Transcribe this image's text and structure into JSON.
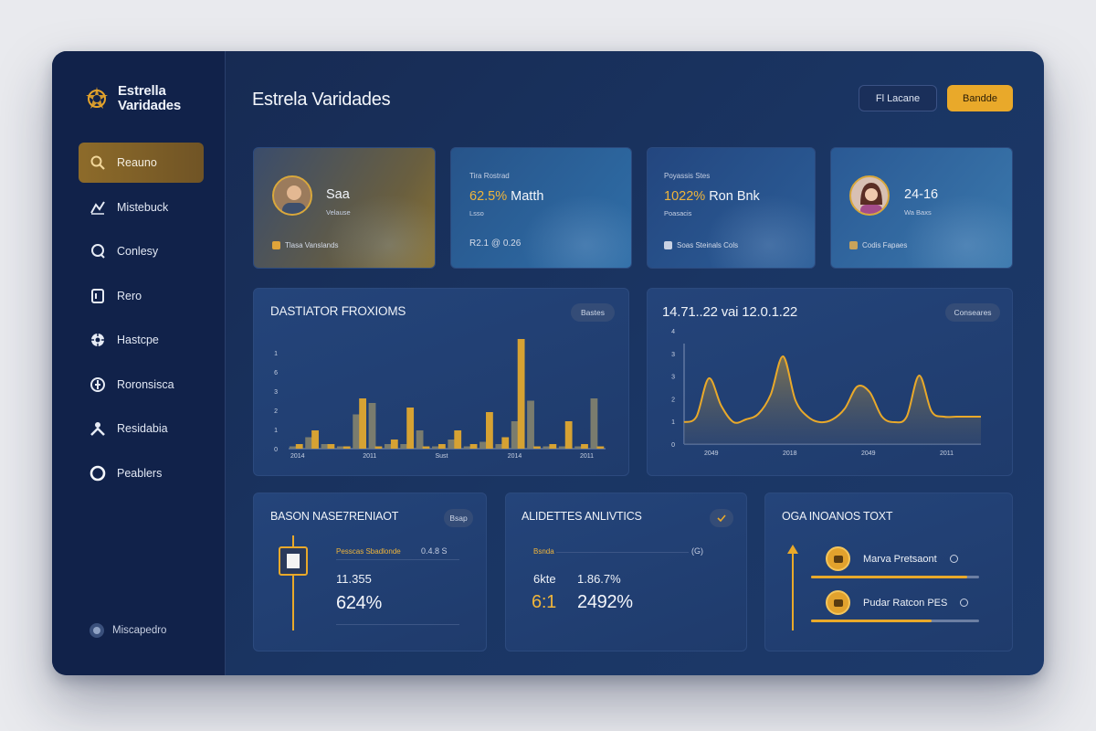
{
  "app": {
    "logo_line1": "Estrella",
    "logo_line2": "Varidades",
    "title": "Estrela Varidades"
  },
  "header": {
    "outline_button": "Fl Lacane",
    "primary_button": "Bandde"
  },
  "sidebar": {
    "items": [
      {
        "label": "Reauno",
        "icon": "search-icon"
      },
      {
        "label": "Mistebuck",
        "icon": "chart-icon"
      },
      {
        "label": "Conlesy",
        "icon": "settings-icon"
      },
      {
        "label": "Rero",
        "icon": "document-icon"
      },
      {
        "label": "Hastcpe",
        "icon": "gear-icon"
      },
      {
        "label": "Roronsisca",
        "icon": "globe-icon"
      },
      {
        "label": "Residabia",
        "icon": "user-icon"
      },
      {
        "label": "Peablers",
        "icon": "circle-icon"
      }
    ],
    "footer": "Miscapedro"
  },
  "stats": [
    {
      "main": "Saa",
      "sub": "Velause",
      "foot": "Tlasa Vanslands"
    },
    {
      "label": "Tira Rostrad",
      "highlight": "62.5%",
      "main": "Matth",
      "sub": "Lsso",
      "foot": "R2.1 @ 0.26"
    },
    {
      "label": "Poyassis Stes",
      "highlight": "1022%",
      "main": "Ron Bnk",
      "sub": "Poasacis",
      "foot": "Soas Steinals Cols"
    },
    {
      "main": "24-16",
      "sub": "Wa Baxs",
      "foot": "Codis Fapaes"
    }
  ],
  "panel_bar": {
    "title": "DASTIATOR FROXIOMS",
    "pill": "Bastes"
  },
  "panel_line": {
    "title": "14.71..22 vai 12.0.1.22",
    "pill": "Conseares"
  },
  "panel_a": {
    "title": "BASON NASE7RENIAOT",
    "pill": "Bsap",
    "row_label": "Pesscas Sbadlonde",
    "row_value": "0.4.8 S",
    "value_mid": "11.355",
    "value_big": "624%"
  },
  "panel_b": {
    "title": "ALIDETTES ANLIVTICS",
    "row_label": "Bsnda",
    "row_value": "(G)",
    "left_top": "6kte",
    "right_top": "1.86.7%",
    "left_big": "6:1",
    "right_big": "2492%"
  },
  "panel_c": {
    "title": "OGA INOANOS TOXT",
    "items": [
      {
        "label": "Marva Pretsaont",
        "progress": 0.93
      },
      {
        "label": "Pudar Ratcon PES",
        "progress": 0.72
      }
    ]
  },
  "chart_data": [
    {
      "type": "bar",
      "title": "DASTIATOR FROXIOMS",
      "x_ticks": [
        "2014",
        "2011",
        "Sust",
        "2014",
        "2011"
      ],
      "y_ticks": [
        "0",
        "1",
        "2",
        "3",
        "6",
        "1"
      ],
      "series": [
        {
          "color": "#7a7c6e",
          "values": [
            0.1,
            0.5,
            0.2,
            0.1,
            1.5,
            2.0,
            0.2,
            0.2,
            0.8,
            0.1,
            0.4,
            0.1,
            0.3,
            0.2,
            1.2,
            2.1,
            0.1,
            0.1,
            0.1,
            2.2
          ]
        },
        {
          "color": "#d6a233",
          "values": [
            0.2,
            0.8,
            0.2,
            0.1,
            2.2,
            0.1,
            0.4,
            1.8,
            0.1,
            0.2,
            0.8,
            0.2,
            1.6,
            0.5,
            4.8,
            0.1,
            0.2,
            1.2,
            0.2,
            0.1
          ]
        }
      ]
    },
    {
      "type": "area",
      "title": "14.71..22 vai 12.0.1.22",
      "x_ticks": [
        "2049",
        "2018",
        "2049",
        "2011"
      ],
      "y_ticks": [
        "0",
        "1",
        "2",
        "3",
        "3",
        "4"
      ],
      "x": [
        0,
        1,
        2,
        3,
        4,
        5,
        6,
        7,
        8,
        9,
        10,
        11,
        12,
        13,
        14,
        15,
        16,
        17,
        18,
        19,
        20,
        21,
        22,
        23,
        24
      ],
      "values": [
        0.8,
        1.0,
        2.4,
        1.4,
        0.8,
        0.9,
        1.1,
        1.8,
        3.2,
        1.6,
        1.0,
        0.8,
        0.9,
        1.3,
        2.1,
        1.9,
        1.0,
        0.8,
        1.0,
        2.5,
        1.2,
        1.0,
        1.0,
        1.0,
        1.0
      ]
    }
  ]
}
